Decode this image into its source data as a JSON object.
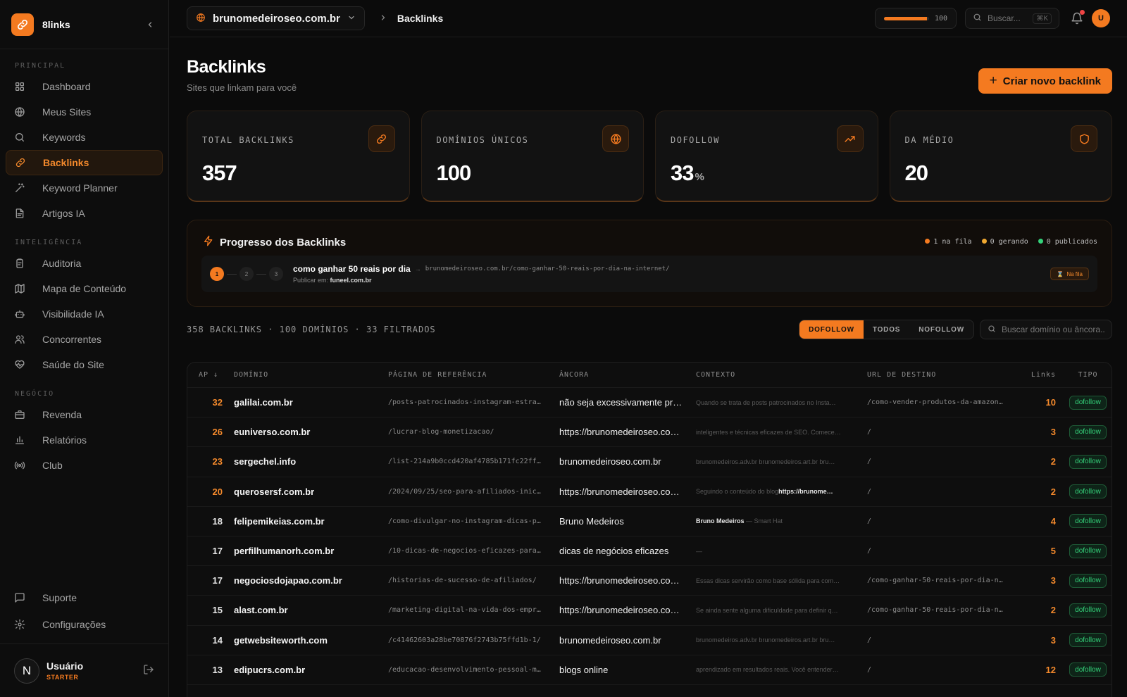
{
  "app": {
    "name": "8links"
  },
  "sidebar": {
    "sections": [
      {
        "label": "PRINCIPAL",
        "items": [
          {
            "label": "Dashboard",
            "icon": "grid-icon"
          },
          {
            "label": "Meus Sites",
            "icon": "globe-icon"
          },
          {
            "label": "Keywords",
            "icon": "search-icon"
          },
          {
            "label": "Backlinks",
            "icon": "link-icon",
            "active": true
          },
          {
            "label": "Keyword Planner",
            "icon": "wand-icon"
          },
          {
            "label": "Artigos IA",
            "icon": "document-icon"
          }
        ]
      },
      {
        "label": "INTELIGÊNCIA",
        "items": [
          {
            "label": "Auditoria",
            "icon": "clipboard-icon"
          },
          {
            "label": "Mapa de Conteúdo",
            "icon": "map-icon"
          },
          {
            "label": "Visibilidade IA",
            "icon": "bot-icon"
          },
          {
            "label": "Concorrentes",
            "icon": "users-icon"
          },
          {
            "label": "Saúde do Site",
            "icon": "heart-pulse-icon"
          }
        ]
      },
      {
        "label": "NEGÓCIO",
        "items": [
          {
            "label": "Revenda",
            "icon": "briefcase-icon"
          },
          {
            "label": "Relatórios",
            "icon": "bar-chart-icon"
          },
          {
            "label": "Club",
            "icon": "radio-icon"
          }
        ]
      }
    ],
    "bottom": [
      {
        "label": "Suporte",
        "icon": "message-icon"
      },
      {
        "label": "Configurações",
        "icon": "gear-icon"
      }
    ],
    "user": {
      "initial": "N",
      "name": "Usuário",
      "plan": "STARTER"
    }
  },
  "topbar": {
    "site": "brunomedeiroseo.com.br",
    "breadcrumb": "Backlinks",
    "credits": {
      "value": "100",
      "fraction": 0.95
    },
    "search": {
      "placeholder": "Buscar...",
      "shortcut": "⌘K"
    },
    "avatar": "U"
  },
  "page": {
    "title": "Backlinks",
    "subtitle": "Sites que linkam para você",
    "create_label": "Criar novo backlink"
  },
  "stats": [
    {
      "label": "TOTAL BACKLINKS",
      "value": "357",
      "suffix": "",
      "icon": "link-icon"
    },
    {
      "label": "DOMÍNIOS ÚNICOS",
      "value": "100",
      "suffix": "",
      "icon": "globe-icon"
    },
    {
      "label": "DOFOLLOW",
      "value": "33",
      "suffix": "%",
      "icon": "trending-up-icon"
    },
    {
      "label": "DA MÉDIO",
      "value": "20",
      "suffix": "",
      "icon": "shield-icon"
    }
  ],
  "progress": {
    "title": "Progresso dos Backlinks",
    "legend": [
      {
        "label": "1 na fila",
        "color": "#f47a20"
      },
      {
        "label": "0 gerando",
        "color": "#f0a830"
      },
      {
        "label": "0 publicados",
        "color": "#34d27a"
      }
    ],
    "item": {
      "steps": [
        "1",
        "2",
        "3"
      ],
      "keyword": "como ganhar 50 reais por dia",
      "arrow": "→",
      "url": "brunomedeiroseo.com.br/como-ganhar-50-reais-por-dia-na-internet/",
      "publish_label": "Publicar em:",
      "publish_site": "funeel.com.br",
      "status": "Na fila"
    }
  },
  "table": {
    "summary": "358 BACKLINKS · 100 DOMÍNIOS · 33 FILTRADOS",
    "filters": [
      "DOFOLLOW",
      "TODOS",
      "NOFOLLOW"
    ],
    "active_filter": "DOFOLLOW",
    "search_placeholder": "Buscar domínio ou âncora...",
    "columns": [
      "AP ↓",
      "DOMÍNIO",
      "PÁGINA DE REFERÊNCIA",
      "ÂNCORA",
      "CONTEXTO",
      "URL DE DESTINO",
      "Links",
      "TIPO"
    ],
    "rows": [
      {
        "ap": "32",
        "domain": "galilai.com.br",
        "ref": "/posts-patrocinados-instagram-estra…",
        "anchor": "não seja excessivamente pro…",
        "ctx_bold": "",
        "ctx": "Quando se trata de posts patrocinados no Insta…",
        "dest": "/como-vender-produtos-da-amazon…",
        "links": "10",
        "tipo": "dofollow"
      },
      {
        "ap": "26",
        "domain": "euniverso.com.br",
        "ref": "/lucrar-blog-monetizacao/",
        "anchor": "https://brunomedeiroseo.com…",
        "ctx_bold": "",
        "ctx": "inteligentes e técnicas eficazes de SEO. Comece…",
        "dest": "/",
        "links": "3",
        "tipo": "dofollow"
      },
      {
        "ap": "23",
        "domain": "sergechel.info",
        "ref": "/list-214a9b0ccd420af4785b171fc22ff…",
        "anchor": "brunomedeiroseo.com.br",
        "ctx_bold": "",
        "ctx": "brunomedeiros.adv.br brunomedeiros.art.br bru…",
        "dest": "/",
        "links": "2",
        "tipo": "dofollow"
      },
      {
        "ap": "20",
        "domain": "querosersf.com.br",
        "ref": "/2024/09/25/seo-para-afiliados-inic…",
        "anchor": "https://brunomedeiroseo.com…",
        "ctx_pre": "Seguindo o conteúdo do blog",
        "ctx_bold": "https://brunome…",
        "ctx": "",
        "dest": "/",
        "links": "2",
        "tipo": "dofollow"
      },
      {
        "ap": "18",
        "domain": "felipemikeias.com.br",
        "ref": "/como-divulgar-no-instagram-dicas-p…",
        "anchor": "Bruno Medeiros",
        "ctx_bold": "Bruno Medeiros",
        "ctx": " — Smart Hat",
        "dest": "/",
        "links": "4",
        "tipo": "dofollow"
      },
      {
        "ap": "17",
        "domain": "perfilhumanorh.com.br",
        "ref": "/10-dicas-de-negocios-eficazes-para…",
        "anchor": "dicas de negócios eficazes",
        "ctx_bold": "",
        "ctx": "—",
        "dest": "/",
        "links": "5",
        "tipo": "dofollow"
      },
      {
        "ap": "17",
        "domain": "negociosdojapao.com.br",
        "ref": "/historias-de-sucesso-de-afiliados/",
        "anchor": "https://brunomedeiroseo.com…",
        "ctx_bold": "",
        "ctx": "Essas dicas servirão como base sólida para com…",
        "dest": "/como-ganhar-50-reais-por-dia-n…",
        "links": "3",
        "tipo": "dofollow"
      },
      {
        "ap": "15",
        "domain": "alast.com.br",
        "ref": "/marketing-digital-na-vida-dos-empr…",
        "anchor": "https://brunomedeiroseo.com…",
        "ctx_bold": "",
        "ctx": "Se ainda sente alguma dificuldade para definir q…",
        "dest": "/como-ganhar-50-reais-por-dia-n…",
        "links": "2",
        "tipo": "dofollow"
      },
      {
        "ap": "14",
        "domain": "getwebsiteworth.com",
        "ref": "/c41462603a28be70876f2743b75ffd1b-1/",
        "anchor": "brunomedeiroseo.com.br",
        "ctx_bold": "",
        "ctx": "brunomedeiros.adv.br brunomedeiros.art.br bru…",
        "dest": "/",
        "links": "3",
        "tipo": "dofollow"
      },
      {
        "ap": "13",
        "domain": "edipucrs.com.br",
        "ref": "/educacao-desenvolvimento-pessoal-m…",
        "anchor": "blogs online",
        "ctx_bold": "",
        "ctx": "aprendizado em resultados reais. Você entender…",
        "dest": "/",
        "links": "12",
        "tipo": "dofollow"
      }
    ]
  },
  "colors": {
    "accent": "#f47a20",
    "success": "#34d27a",
    "background": "#0b0b0b"
  }
}
